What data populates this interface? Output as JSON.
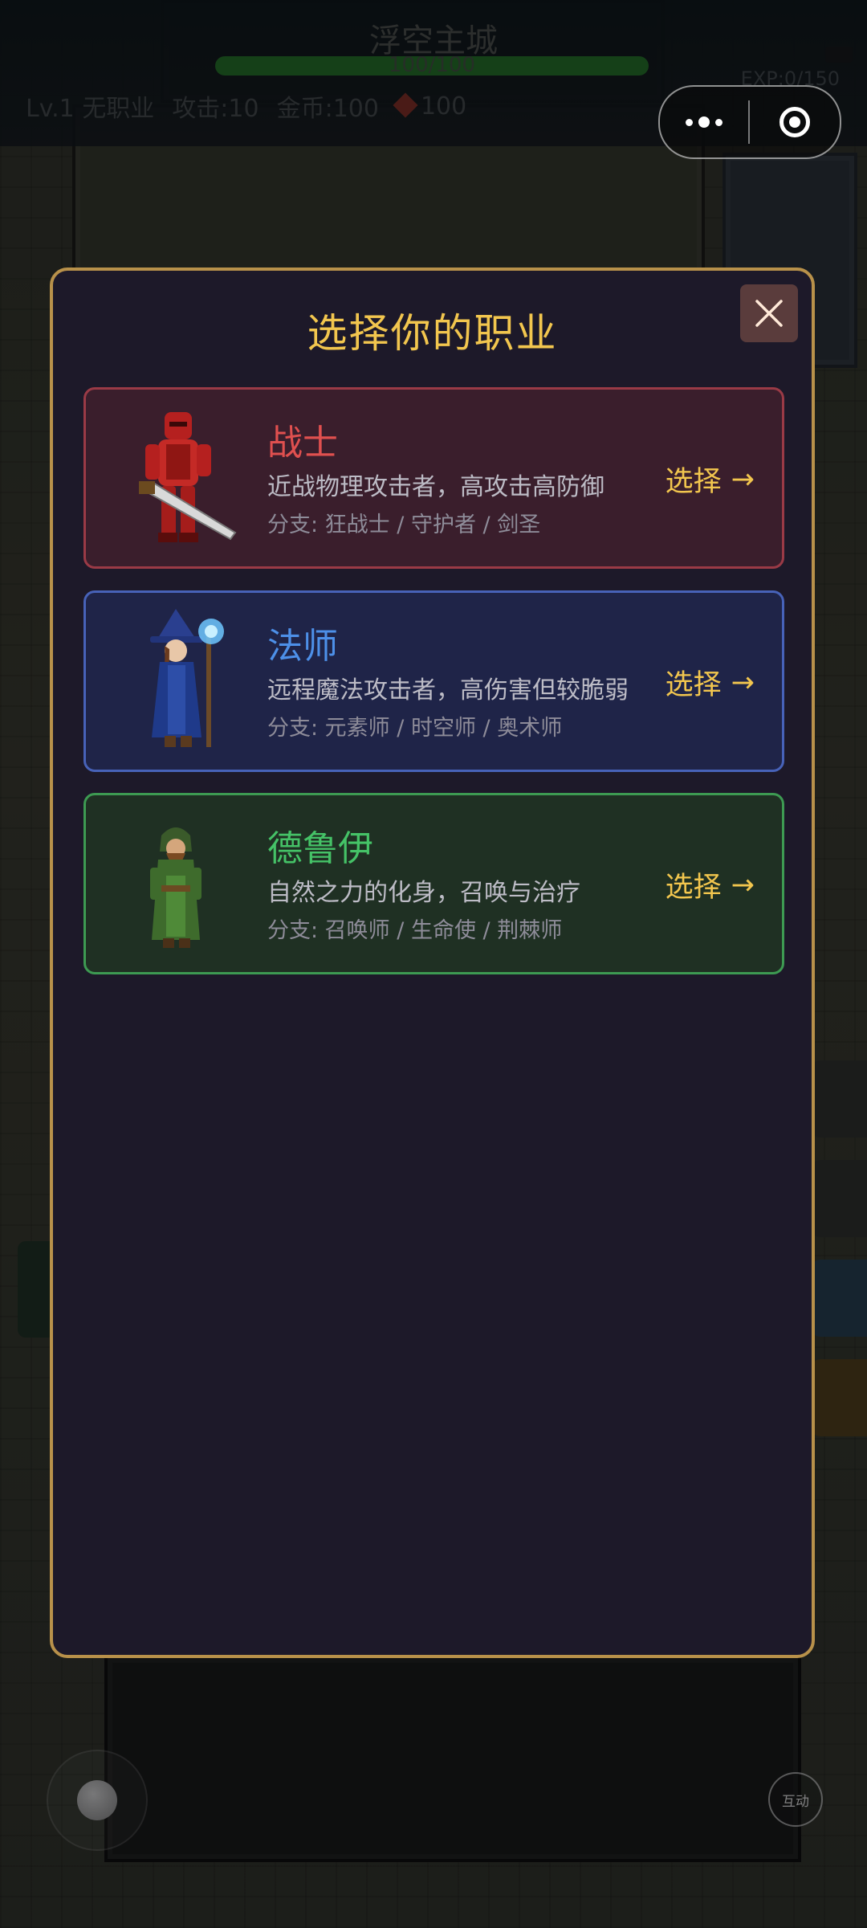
{
  "hud": {
    "location": "浮空主城",
    "hp": "100/100",
    "hp_fraction": 1.0,
    "level": "Lv.1",
    "job": "无职业",
    "attack": "攻击:10",
    "gold": "金币:100",
    "gems": "100",
    "exp": "EXP:0/150"
  },
  "modal": {
    "title": "选择你的职业",
    "close_icon": "close-icon"
  },
  "classes": [
    {
      "name": "战士",
      "description": "近战物理攻击者，高攻击高防御",
      "branches": "分支: 狂战士 / 守护者 / 剑圣",
      "select_label": "选择",
      "arrow": "→",
      "color": "#e0504f"
    },
    {
      "name": "法师",
      "description": "远程魔法攻击者，高伤害但较脆弱",
      "branches": "分支: 元素师 / 时空师 / 奥术师",
      "select_label": "选择",
      "arrow": "→",
      "color": "#4d90e8"
    },
    {
      "name": "德鲁伊",
      "description": "自然之力的化身，召唤与治疗",
      "branches": "分支: 召唤师 / 生命使 / 荆棘师",
      "select_label": "选择",
      "arrow": "→",
      "color": "#45c267"
    }
  ],
  "controls": {
    "interact_label": "互动"
  },
  "colors": {
    "accent_gold": "#f2c64e",
    "modal_border": "#b8914a"
  }
}
